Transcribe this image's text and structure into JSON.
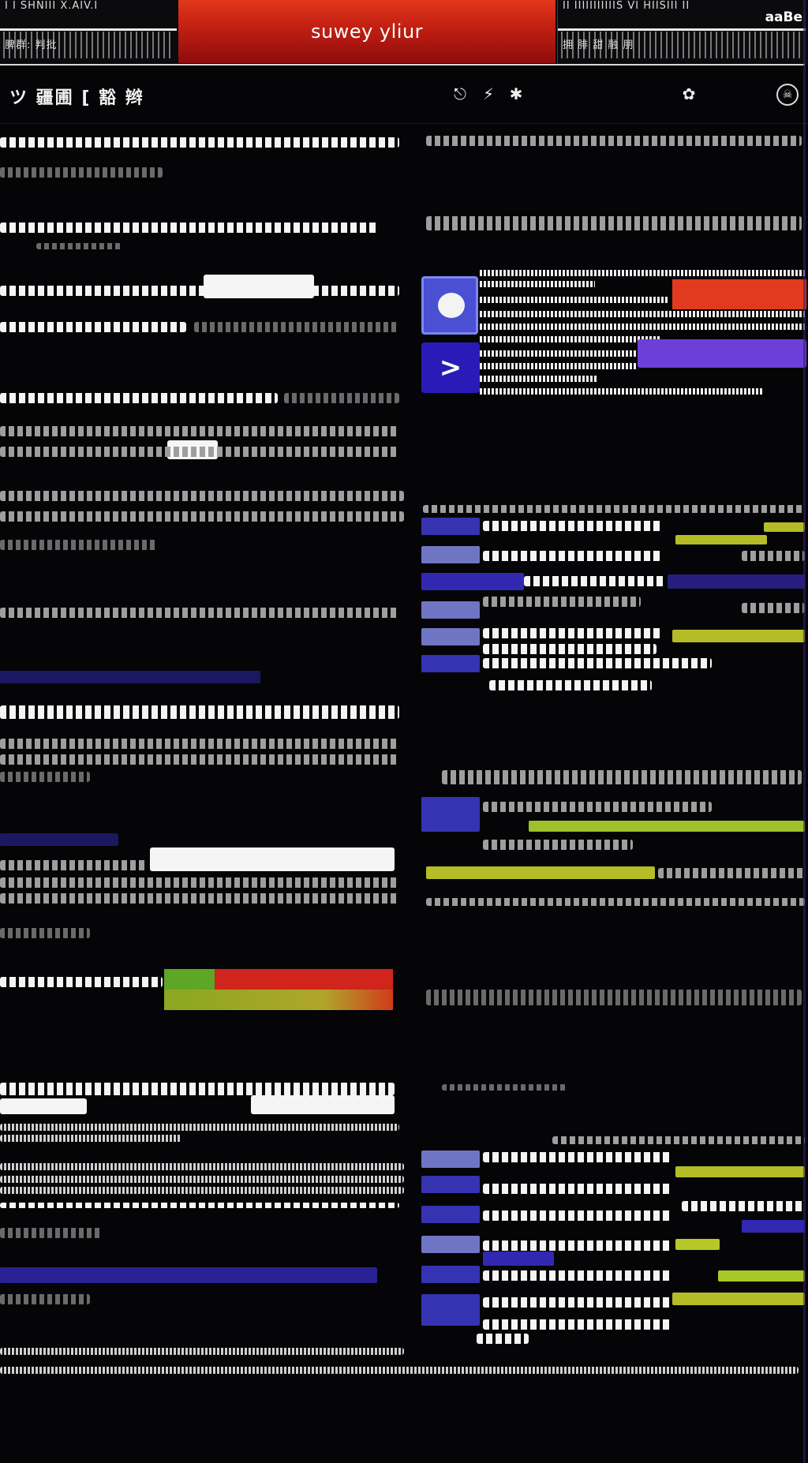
{
  "banner": {
    "title": "suwey yliur",
    "left_row1": "I I SHNIII X.AIV.I",
    "left_row2": "脾群: 判批",
    "right_row1": "II IIIIIIIIIIIS VI HIISIII II",
    "right_row2": "拥 腓 甜 融 朋",
    "right_corner": "aaBe"
  },
  "nav": {
    "brand": "ツ 疆圃 [ 豁 辫"
  },
  "colors": {
    "banner_red": "#c11e12",
    "accent_blue": "#3b39c4",
    "accent_purple": "#6b3fd8",
    "accent_yellow": "#c9d22a",
    "accent_green": "#5ea626",
    "background": "#050507"
  },
  "icons": {
    "nav": [
      "lamp-icon",
      "plug-icon",
      "sparkle-icon",
      "bird-icon",
      "skull-icon"
    ],
    "promo": [
      "blob-icon",
      "chevron-right-icon"
    ]
  },
  "promo": {
    "next_label": ">"
  },
  "progress": {
    "green_fraction": 0.22,
    "red_fraction": 0.78
  }
}
